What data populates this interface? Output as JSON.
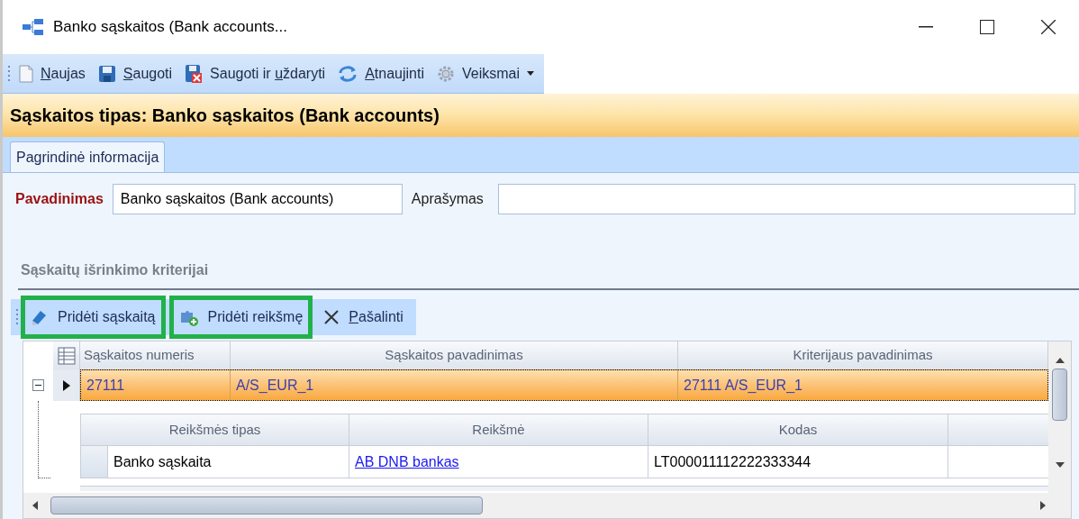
{
  "window": {
    "title": "Banko sąskaitos (Bank accounts..."
  },
  "toolbar": [
    {
      "kind": "new",
      "label_parts": [
        {
          "text": "N",
          "underline": true
        },
        {
          "text": "aujas",
          "underline": false
        }
      ]
    },
    {
      "kind": "save",
      "label_parts": [
        {
          "text": "S",
          "underline": true
        },
        {
          "text": "augoti",
          "underline": false
        }
      ]
    },
    {
      "kind": "save_close",
      "label_parts": [
        {
          "text": "Saugoti ir ",
          "underline": false
        },
        {
          "text": "u",
          "underline": true
        },
        {
          "text": "ždaryti",
          "underline": false
        }
      ]
    },
    {
      "kind": "refresh",
      "label_parts": [
        {
          "text": "A",
          "underline": true
        },
        {
          "text": "tnaujinti",
          "underline": false
        }
      ]
    },
    {
      "kind": "actions",
      "label_parts": [
        {
          "text": "Veiksmai",
          "underline": false
        }
      ]
    }
  ],
  "header": {
    "title": "Sąskaitos tipas: Banko sąskaitos (Bank accounts)"
  },
  "tabs": [
    {
      "label": "Pagrindinė informacija",
      "selected": true
    }
  ],
  "form": {
    "fields": [
      {
        "label": "Pavadinimas",
        "required": true,
        "value": "Banko sąskaitos (Bank accounts)"
      },
      {
        "label": "Aprašymas",
        "required": false
      }
    ]
  },
  "section": {
    "title": "Sąskaitų išrinkimo kriterijai"
  },
  "grid_toolbar": [
    {
      "kind": "add_account",
      "highlighted": true,
      "label_parts": [
        {
          "text": "Pridėti sąskaitą",
          "underline": false
        }
      ]
    },
    {
      "kind": "add_value",
      "highlighted": true,
      "label_parts": [
        {
          "text": "Pridėti reikšmę",
          "underline": false
        }
      ]
    },
    {
      "kind": "delete",
      "highlighted": false,
      "label_parts": [
        {
          "text": "P",
          "underline": true
        },
        {
          "text": "ašalinti",
          "underline": false
        }
      ]
    }
  ],
  "grid": {
    "columns": [
      "Sąskaitos numeris",
      "Sąskaitos pavadinimas",
      "Kriterijaus pavadinimas"
    ],
    "rows": [
      {
        "cells": [
          "27111",
          "A/S_EUR_1",
          "27111 A/S_EUR_1"
        ],
        "selected": true,
        "expanded": true,
        "detail": {
          "columns": [
            "Reikšmės tipas",
            "Reikšmė",
            "Kodas"
          ],
          "rows": [
            {
              "cells": [
                {
                  "kind": "text",
                  "text": "Banko sąskaita"
                },
                {
                  "kind": "link",
                  "text": "AB DNB bankas"
                },
                {
                  "kind": "text",
                  "text": "LT000011112222333344"
                }
              ]
            }
          ]
        }
      }
    ]
  }
}
